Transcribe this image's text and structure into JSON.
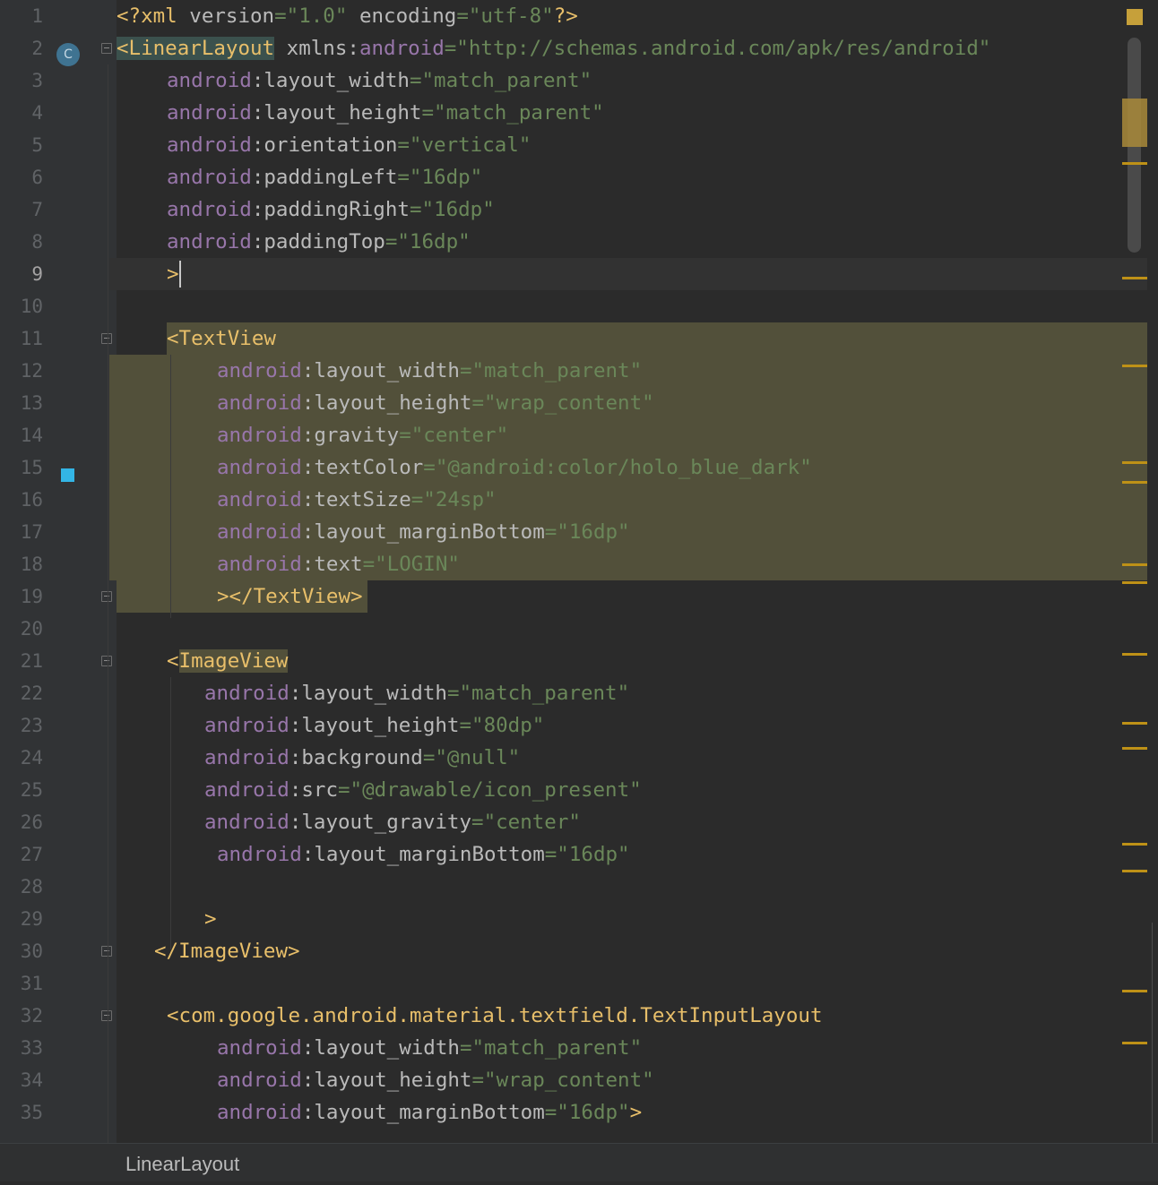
{
  "editor": {
    "caret_line": 9,
    "lines": [
      {
        "n": "1",
        "indent": 0,
        "tokens": [
          [
            "tag",
            "<?xml"
          ],
          [
            "plain",
            " "
          ],
          [
            "attr",
            "version"
          ],
          [
            "str",
            "=\"1.0\""
          ],
          [
            "plain",
            " "
          ],
          [
            "attr",
            "encoding"
          ],
          [
            "str",
            "=\"utf-8\""
          ],
          [
            "tag",
            "?>"
          ]
        ]
      },
      {
        "n": "2",
        "indent": 0,
        "tokens": [
          [
            "tagbox",
            "<LinearLayout"
          ],
          [
            "plain",
            " "
          ],
          [
            "attr",
            "xmlns:"
          ],
          [
            "ns",
            "android"
          ],
          [
            "str",
            "=\"http://schemas.android.com/apk/res/android\""
          ]
        ]
      },
      {
        "n": "3",
        "indent": 4,
        "tokens": [
          [
            "ns",
            "android"
          ],
          [
            "attr",
            ":layout_width"
          ],
          [
            "str",
            "=\"match_parent\""
          ]
        ]
      },
      {
        "n": "4",
        "indent": 4,
        "tokens": [
          [
            "ns",
            "android"
          ],
          [
            "attr",
            ":layout_height"
          ],
          [
            "str",
            "=\"match_parent\""
          ]
        ]
      },
      {
        "n": "5",
        "indent": 4,
        "tokens": [
          [
            "ns",
            "android"
          ],
          [
            "attr",
            ":orientation"
          ],
          [
            "str",
            "=\"vertical\""
          ]
        ]
      },
      {
        "n": "6",
        "indent": 4,
        "tokens": [
          [
            "ns",
            "android"
          ],
          [
            "attr",
            ":paddingLeft"
          ],
          [
            "str",
            "=\"16dp\""
          ]
        ]
      },
      {
        "n": "7",
        "indent": 4,
        "tokens": [
          [
            "ns",
            "android"
          ],
          [
            "attr",
            ":paddingRight"
          ],
          [
            "str",
            "=\"16dp\""
          ]
        ]
      },
      {
        "n": "8",
        "indent": 4,
        "tokens": [
          [
            "ns",
            "android"
          ],
          [
            "attr",
            ":paddingTop"
          ],
          [
            "str",
            "=\"16dp\""
          ]
        ]
      },
      {
        "n": "9",
        "indent": 4,
        "tokens": [
          [
            "tag",
            ">"
          ]
        ]
      },
      {
        "n": "10",
        "indent": 0,
        "tokens": []
      },
      {
        "n": "11",
        "indent": 4,
        "tokens": [
          [
            "tag",
            "<TextView"
          ]
        ]
      },
      {
        "n": "12",
        "indent": 8,
        "tokens": [
          [
            "ns",
            "android"
          ],
          [
            "attr",
            ":layout_width"
          ],
          [
            "str",
            "=\"match_parent\""
          ]
        ]
      },
      {
        "n": "13",
        "indent": 8,
        "tokens": [
          [
            "ns",
            "android"
          ],
          [
            "attr",
            ":layout_height"
          ],
          [
            "str",
            "=\"wrap_content\""
          ]
        ]
      },
      {
        "n": "14",
        "indent": 8,
        "tokens": [
          [
            "ns",
            "android"
          ],
          [
            "attr",
            ":gravity"
          ],
          [
            "str",
            "=\"center\""
          ]
        ]
      },
      {
        "n": "15",
        "indent": 8,
        "tokens": [
          [
            "ns",
            "android"
          ],
          [
            "attr",
            ":textColor"
          ],
          [
            "str",
            "=\"@android:color/holo_blue_dark\""
          ]
        ]
      },
      {
        "n": "16",
        "indent": 8,
        "tokens": [
          [
            "ns",
            "android"
          ],
          [
            "attr",
            ":textSize"
          ],
          [
            "str",
            "=\"24sp\""
          ]
        ]
      },
      {
        "n": "17",
        "indent": 8,
        "tokens": [
          [
            "ns",
            "android"
          ],
          [
            "attr",
            ":layout_marginBottom"
          ],
          [
            "str",
            "=\"16dp\""
          ]
        ]
      },
      {
        "n": "18",
        "indent": 8,
        "tokens": [
          [
            "ns",
            "android"
          ],
          [
            "attr",
            ":text"
          ],
          [
            "str",
            "=\"LOGIN\""
          ]
        ]
      },
      {
        "n": "19",
        "indent": 8,
        "tokens": [
          [
            "tag",
            "></TextView>"
          ]
        ]
      },
      {
        "n": "20",
        "indent": 0,
        "tokens": []
      },
      {
        "n": "21",
        "indent": 4,
        "tokens": [
          [
            "tag",
            "<"
          ],
          [
            "tagbox2",
            "ImageView"
          ]
        ]
      },
      {
        "n": "22",
        "indent": 7,
        "tokens": [
          [
            "ns",
            "android"
          ],
          [
            "attr",
            ":layout_width"
          ],
          [
            "str",
            "=\"match_parent\""
          ]
        ]
      },
      {
        "n": "23",
        "indent": 7,
        "tokens": [
          [
            "ns",
            "android"
          ],
          [
            "attr",
            ":layout_height"
          ],
          [
            "str",
            "=\"80dp\""
          ]
        ]
      },
      {
        "n": "24",
        "indent": 7,
        "tokens": [
          [
            "ns",
            "android"
          ],
          [
            "attr",
            ":background"
          ],
          [
            "str",
            "=\"@null\""
          ]
        ]
      },
      {
        "n": "25",
        "indent": 7,
        "tokens": [
          [
            "ns",
            "android"
          ],
          [
            "attr",
            ":src"
          ],
          [
            "str",
            "=\"@drawable/icon_present\""
          ]
        ]
      },
      {
        "n": "26",
        "indent": 7,
        "tokens": [
          [
            "ns",
            "android"
          ],
          [
            "attr",
            ":layout_gravity"
          ],
          [
            "str",
            "=\"center\""
          ]
        ]
      },
      {
        "n": "27",
        "indent": 8,
        "tokens": [
          [
            "ns",
            "android"
          ],
          [
            "attr",
            ":layout_marginBottom"
          ],
          [
            "str",
            "=\"16dp\""
          ]
        ]
      },
      {
        "n": "28",
        "indent": 0,
        "tokens": []
      },
      {
        "n": "29",
        "indent": 7,
        "tokens": [
          [
            "tag",
            ">"
          ]
        ]
      },
      {
        "n": "30",
        "indent": 3,
        "tokens": [
          [
            "tag",
            "</ImageView>"
          ]
        ]
      },
      {
        "n": "31",
        "indent": 0,
        "tokens": []
      },
      {
        "n": "32",
        "indent": 4,
        "tokens": [
          [
            "tag",
            "<com.google.android.material.textfield.TextInputLayout"
          ]
        ]
      },
      {
        "n": "33",
        "indent": 8,
        "tokens": [
          [
            "ns",
            "android"
          ],
          [
            "attr",
            ":layout_width"
          ],
          [
            "str",
            "=\"match_parent\""
          ]
        ]
      },
      {
        "n": "34",
        "indent": 8,
        "tokens": [
          [
            "ns",
            "android"
          ],
          [
            "attr",
            ":layout_height"
          ],
          [
            "str",
            "=\"wrap_content\""
          ]
        ]
      },
      {
        "n": "35",
        "indent": 8,
        "tokens": [
          [
            "ns",
            "android"
          ],
          [
            "attr",
            ":layout_marginBottom"
          ],
          [
            "str",
            "=\"16dp\""
          ],
          [
            "tag",
            ">"
          ]
        ]
      }
    ]
  },
  "breadcrumb": {
    "label": "LinearLayout"
  },
  "gutter_icons": {
    "class_badge": "C",
    "color_preview": "#33b5e5"
  },
  "colors": {
    "background": "#2b2b2b",
    "tag": "#e8bf6a",
    "namespace": "#9876aa",
    "attribute": "#bababa",
    "string": "#6a8759",
    "highlight": "#52503a",
    "marker": "#be9117"
  }
}
